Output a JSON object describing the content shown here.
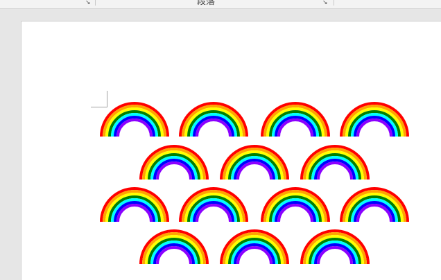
{
  "ribbon": {
    "paragraph_group_label": "段落",
    "launcher_glyph": "↘"
  },
  "document": {
    "rainbow_rows": [
      4,
      3,
      4,
      3
    ],
    "rainbow_colors": [
      "#ff0000",
      "#ffa500",
      "#ffff00",
      "#008000",
      "#00ffff",
      "#0000ff",
      "#8b00ff"
    ]
  }
}
